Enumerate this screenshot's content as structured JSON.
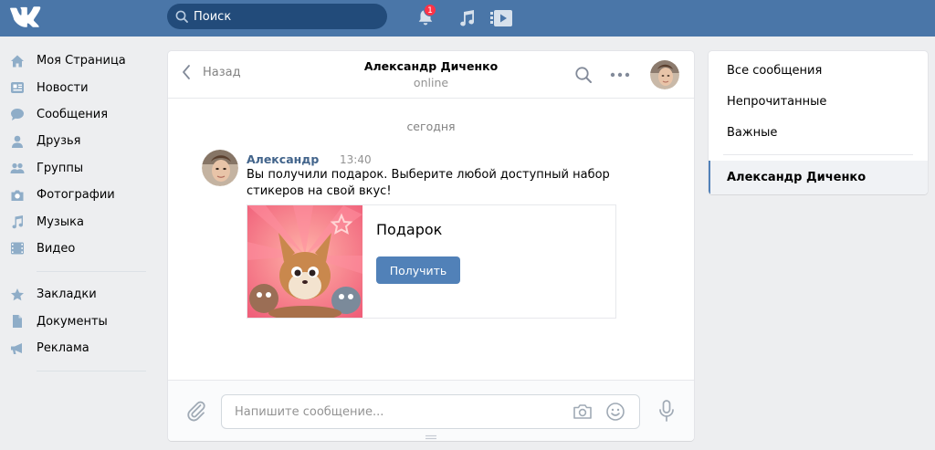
{
  "header": {
    "search_placeholder": "Поиск",
    "notifications_count": "1",
    "colors": {
      "bar": "#4a76a8",
      "search_bg": "#224b7a",
      "badge": "#ff3347"
    }
  },
  "leftnav": {
    "items": [
      {
        "label": "Моя Страница",
        "icon": "home-icon"
      },
      {
        "label": "Новости",
        "icon": "news-icon"
      },
      {
        "label": "Сообщения",
        "icon": "messages-icon"
      },
      {
        "label": "Друзья",
        "icon": "friends-icon"
      },
      {
        "label": "Группы",
        "icon": "groups-icon"
      },
      {
        "label": "Фотографии",
        "icon": "camera-icon"
      },
      {
        "label": "Музыка",
        "icon": "music-icon"
      },
      {
        "label": "Видео",
        "icon": "video-icon"
      }
    ],
    "items2": [
      {
        "label": "Закладки",
        "icon": "star-icon"
      },
      {
        "label": "Документы",
        "icon": "document-icon"
      },
      {
        "label": "Реклама",
        "icon": "megaphone-icon"
      }
    ]
  },
  "chat": {
    "back_label": "Назад",
    "title": "Александр Диченко",
    "status": "online",
    "date_separator": "сегодня",
    "message": {
      "author": "Александр",
      "time": "13:40",
      "text": "Вы получили подарок. Выберите любой доступный набор стикеров на свой вкус!"
    },
    "gift": {
      "title": "Подарок",
      "button_label": "Получить"
    },
    "composer_placeholder": "Напишите сообщение..."
  },
  "rpanel": {
    "items": [
      "Все сообщения",
      "Непрочитанные",
      "Важные"
    ],
    "active": "Александр Диченко"
  }
}
